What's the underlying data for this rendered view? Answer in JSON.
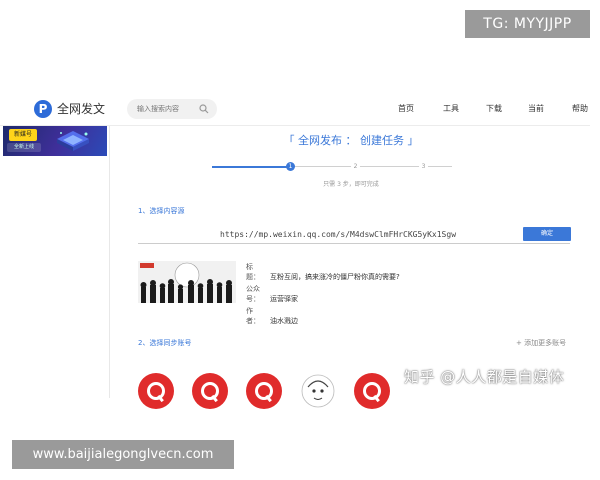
{
  "watermarks": {
    "tg": "TG: MYYJJPP",
    "zhihu": "知乎 @人人都是自媒体",
    "site": "www.baijialegonglvecn.com"
  },
  "header": {
    "logo_letter": "P",
    "brand": "全网发文",
    "search_placeholder": "输入搜索内容",
    "nav": [
      "首页",
      "工具",
      "下载",
      "当前",
      "帮助"
    ]
  },
  "sidebar": {
    "banner_tag": "新媒号",
    "banner_sub": "全新上线"
  },
  "main": {
    "task_title": "「 全网发布 ： 创建任务 」",
    "steps": [
      "1",
      "2",
      "3"
    ],
    "step_hint": "只需 3 步，即可完成",
    "section1": "1、选择内容源",
    "url": "https://mp.weixin.qq.com/s/M4dswClmFHrCKG5yKx1Sgw",
    "confirm": "确定",
    "article": {
      "title_label": "标　题：",
      "title": "互粉互阅，搞来涨冷的僵尸粉你真的需要?",
      "account_label": "公众号：",
      "account": "运营驿家",
      "author_label": "作　者：",
      "author": "油水溅边"
    },
    "section2": "2、选择同步账号",
    "add_accounts": "+ 添加更多账号"
  },
  "colors": {
    "accent": "#3b78d8",
    "avatar_red": "#e02b2b"
  }
}
